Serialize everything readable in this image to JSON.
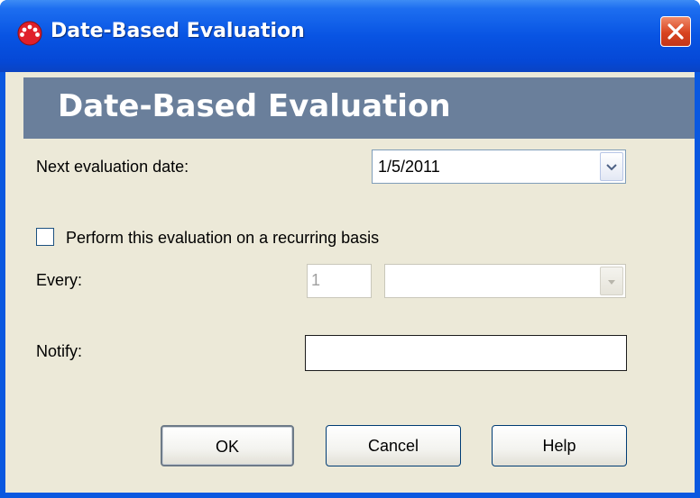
{
  "window": {
    "title": "Date-Based Evaluation",
    "app_icon": "app-dots-icon",
    "close_icon": "close-icon",
    "accent_color": "#0a58e0"
  },
  "banner": {
    "title": "Date-Based Evaluation",
    "color": "#6a7f9b"
  },
  "form": {
    "next_eval_label": "Next evaluation date:",
    "next_eval_value": "1/5/2011",
    "recurring_label": "Perform this evaluation on a recurring basis",
    "recurring_checked": false,
    "every_label": "Every:",
    "every_value": "1",
    "every_unit_value": "",
    "notify_label": "Notify:",
    "notify_value": ""
  },
  "buttons": {
    "ok": "OK",
    "cancel": "Cancel",
    "help": "Help"
  }
}
